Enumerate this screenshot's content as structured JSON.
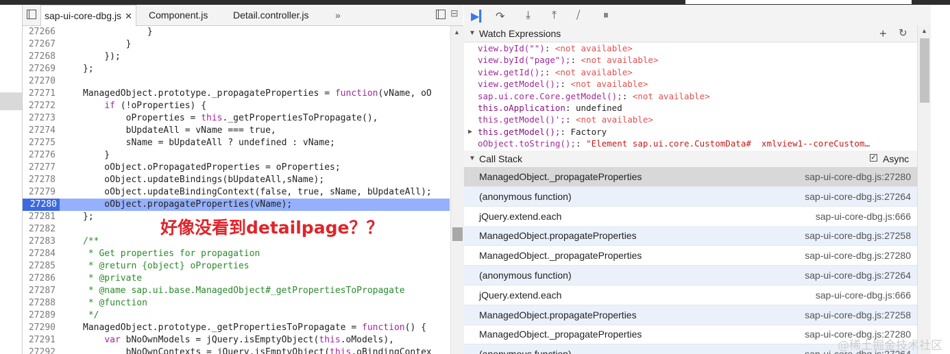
{
  "tabs": [
    {
      "label": "sap-ui-core-dbg.js",
      "close": "✕"
    },
    {
      "label": "Component.js"
    },
    {
      "label": "Detail.controller.js"
    }
  ],
  "tab_overflow": "»",
  "code_lines": [
    {
      "n": "27266",
      "segs": [
        {
          "t": "            }",
          "c": ""
        }
      ]
    },
    {
      "n": "27267",
      "segs": [
        {
          "t": "        }",
          "c": ""
        }
      ]
    },
    {
      "n": "27268",
      "segs": [
        {
          "t": "    });",
          "c": ""
        }
      ]
    },
    {
      "n": "27269",
      "segs": [
        {
          "t": "};",
          "c": ""
        }
      ]
    },
    {
      "n": "27270",
      "segs": [
        {
          "t": "",
          "c": ""
        }
      ]
    },
    {
      "n": "27271",
      "segs": [
        {
          "t": "ManagedObject.prototype._propagateProperties = ",
          "c": ""
        },
        {
          "t": "function",
          "c": "kw"
        },
        {
          "t": "(vName, oO",
          "c": ""
        }
      ]
    },
    {
      "n": "27272",
      "segs": [
        {
          "t": "    ",
          "c": ""
        },
        {
          "t": "if",
          "c": "kw"
        },
        {
          "t": " (!oProperties) {",
          "c": ""
        }
      ]
    },
    {
      "n": "27273",
      "segs": [
        {
          "t": "        oProperties = ",
          "c": ""
        },
        {
          "t": "this",
          "c": "kw"
        },
        {
          "t": "._getPropertiesToPropagate(),",
          "c": ""
        }
      ]
    },
    {
      "n": "27274",
      "segs": [
        {
          "t": "        bUpdateAll = vName === true,",
          "c": ""
        }
      ]
    },
    {
      "n": "27275",
      "segs": [
        {
          "t": "        sName = bUpdateAll ? undefined : vName;",
          "c": ""
        }
      ]
    },
    {
      "n": "27276",
      "segs": [
        {
          "t": "    }",
          "c": ""
        }
      ]
    },
    {
      "n": "27277",
      "segs": [
        {
          "t": "    oObject.oPropagatedProperties = oProperties;",
          "c": ""
        }
      ]
    },
    {
      "n": "27278",
      "segs": [
        {
          "t": "    oObject.updateBindings(bUpdateAll,sName);",
          "c": ""
        }
      ]
    },
    {
      "n": "27279",
      "segs": [
        {
          "t": "    oObject.updateBindingContext(false, true, sName, bUpdateAll);",
          "c": ""
        }
      ]
    },
    {
      "n": "27280",
      "segs": [
        {
          "t": "    oObject.propagateProperties(vName);",
          "c": ""
        }
      ],
      "current": true
    },
    {
      "n": "27281",
      "segs": [
        {
          "t": "};",
          "c": ""
        }
      ]
    },
    {
      "n": "27282",
      "segs": [
        {
          "t": "",
          "c": ""
        }
      ]
    },
    {
      "n": "27283",
      "segs": [
        {
          "t": "/**",
          "c": "cm"
        }
      ]
    },
    {
      "n": "27284",
      "segs": [
        {
          "t": " * Get properties for propagation",
          "c": "cm"
        }
      ]
    },
    {
      "n": "27285",
      "segs": [
        {
          "t": " * @return {object} oProperties",
          "c": "cm"
        }
      ]
    },
    {
      "n": "27286",
      "segs": [
        {
          "t": " * @private",
          "c": "cm"
        }
      ]
    },
    {
      "n": "27287",
      "segs": [
        {
          "t": " * @name sap.ui.base.ManagedObject#_getPropertiesToPropagate",
          "c": "cm"
        }
      ]
    },
    {
      "n": "27288",
      "segs": [
        {
          "t": " * @function",
          "c": "cm"
        }
      ]
    },
    {
      "n": "27289",
      "segs": [
        {
          "t": " */",
          "c": "cm"
        }
      ]
    },
    {
      "n": "27290",
      "segs": [
        {
          "t": "ManagedObject.prototype._getPropertiesToPropagate = ",
          "c": ""
        },
        {
          "t": "function",
          "c": "kw"
        },
        {
          "t": "() {",
          "c": ""
        }
      ]
    },
    {
      "n": "27291",
      "segs": [
        {
          "t": "    ",
          "c": ""
        },
        {
          "t": "var",
          "c": "kw"
        },
        {
          "t": " bNoOwnModels = jQuery.isEmptyObject(",
          "c": ""
        },
        {
          "t": "this",
          "c": "kw"
        },
        {
          "t": ".oModels),",
          "c": ""
        }
      ]
    },
    {
      "n": "27292",
      "segs": [
        {
          "t": "        bNoOwnContexts = jQuery.isEmptyObject(",
          "c": ""
        },
        {
          "t": "this",
          "c": "kw"
        },
        {
          "t": ".oBindingContex",
          "c": ""
        }
      ]
    }
  ],
  "overlay_text": "好像没看到detailpage？？",
  "watch": {
    "title": "Watch Expressions",
    "add": "+",
    "refresh": "↻",
    "items": [
      {
        "expr": "view.byId(\"\")",
        "sep": ": ",
        "val": "<not available>",
        "vc": "err"
      },
      {
        "expr": "view.byId(\"page\");",
        "sep": ": ",
        "val": "<not available>",
        "vc": "err"
      },
      {
        "expr": "view.getId();",
        "sep": ": ",
        "val": "<not available>",
        "vc": "err"
      },
      {
        "expr": "view.getModel();",
        "sep": ": ",
        "val": "<not available>",
        "vc": "err"
      },
      {
        "expr": "sap.ui.core.Core.getModel();",
        "sep": ": ",
        "val": "<not available>",
        "vc": "err"
      },
      {
        "expr": "this.oApplication",
        "sep": ": ",
        "val": "undefined",
        "vc": "plain",
        "dark": true
      },
      {
        "expr": "this.getModel()';",
        "sep": ": ",
        "val": "<not available>",
        "vc": "err"
      },
      {
        "expr": "this.getModel();",
        "sep": ": ",
        "val": "Factory",
        "vc": "plain",
        "dark": true,
        "expand": "▶"
      },
      {
        "expr": "oObject.toString();",
        "sep": ": ",
        "val": "\"Element sap.ui.core.CustomData#  xmlview1--coreCustom…",
        "vc": "str"
      }
    ]
  },
  "callstack": {
    "title": "Call Stack",
    "async_label": "Async",
    "rows": [
      {
        "fn": "ManagedObject._propagateProperties",
        "loc": "sap-ui-core-dbg.js:27280",
        "sel": true
      },
      {
        "fn": "(anonymous function)",
        "loc": "sap-ui-core-dbg.js:27264",
        "alt": true
      },
      {
        "fn": "jQuery.extend.each",
        "loc": "sap-ui-core-dbg.js:666"
      },
      {
        "fn": "ManagedObject.propagateProperties",
        "loc": "sap-ui-core-dbg.js:27258",
        "alt": true
      },
      {
        "fn": "ManagedObject._propagateProperties",
        "loc": "sap-ui-core-dbg.js:27280"
      },
      {
        "fn": "(anonymous function)",
        "loc": "sap-ui-core-dbg.js:27264",
        "alt": true
      },
      {
        "fn": "jQuery.extend.each",
        "loc": "sap-ui-core-dbg.js:666"
      },
      {
        "fn": "ManagedObject.propagateProperties",
        "loc": "sap-ui-core-dbg.js:27258",
        "alt": true
      },
      {
        "fn": "ManagedObject._propagateProperties",
        "loc": "sap-ui-core-dbg.js:27280"
      },
      {
        "fn": "(anonymous function)",
        "loc": "sap-ui-core-dbg.js:27264",
        "alt": true
      }
    ]
  },
  "watermark": "@稀土掘金技术社区",
  "colors": {
    "current_line": "#94b0ff",
    "keyword": "#a0289b",
    "comment": "#2a8a2a",
    "not_available": "#e05050"
  }
}
